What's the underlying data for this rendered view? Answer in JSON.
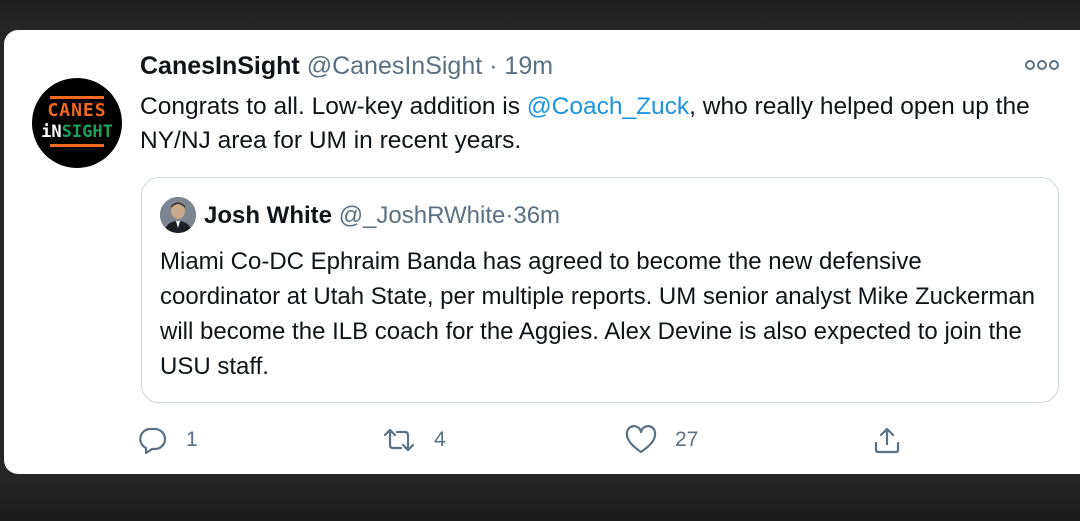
{
  "tweet": {
    "display_name": "CanesInSight",
    "handle": "@CanesInSight",
    "separator": "·",
    "time": "19m",
    "avatar_logo": {
      "line1": "CANES",
      "line2_a": "iN",
      "line2_b": "SIGHT"
    },
    "text_before": "Congrats to all. Low-key addition is ",
    "mention": "@Coach_Zuck",
    "text_after": ", who really helped open up the NY/NJ area for UM in recent years.",
    "more_icon": "more-horizontal-icon"
  },
  "quoted_tweet": {
    "display_name": "Josh White",
    "handle": "@_JoshRWhite",
    "separator": "·",
    "time": "36m",
    "text": "Miami Co-DC Ephraim Banda has agreed to become the new defensive coordinator at Utah State, per multiple reports. UM senior analyst Mike Zuckerman will become the ILB coach for the Aggies. Alex Devine is also expected to join the USU staff."
  },
  "actions": {
    "reply": {
      "icon": "reply-icon",
      "count": "1"
    },
    "retweet": {
      "icon": "retweet-icon",
      "count": "4"
    },
    "like": {
      "icon": "heart-icon",
      "count": "27"
    },
    "share": {
      "icon": "share-icon"
    }
  },
  "colors": {
    "background": "#262626",
    "card": "#ffffff",
    "text": "#0f1419",
    "secondary": "#5b7083",
    "link": "#1b95e0",
    "quote_border": "#cfd9de",
    "logo_orange": "#f26a21",
    "logo_green": "#1aa05a"
  }
}
